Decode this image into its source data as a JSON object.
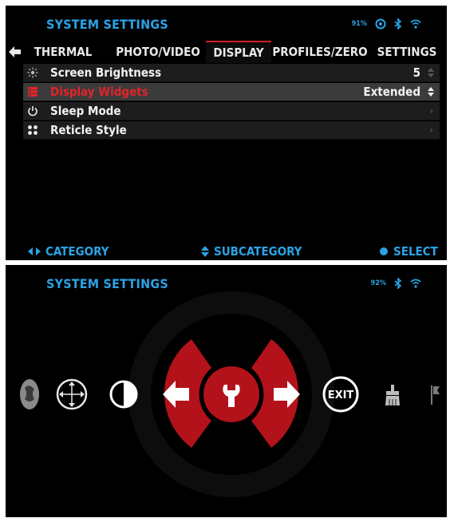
{
  "top_screen": {
    "title": "SYSTEM SETTINGS",
    "battery": "91%",
    "tabs": [
      {
        "label": "THERMAL"
      },
      {
        "label": "PHOTO/VIDEO"
      },
      {
        "label": "DISPLAY",
        "active": true
      },
      {
        "label": "PROFILES/ZERO"
      },
      {
        "label": "SETTINGS"
      }
    ],
    "rows": [
      {
        "label": "Screen Brightness",
        "value": "5",
        "icon": "brightness-icon"
      },
      {
        "label": "Display Widgets",
        "value": "Extended",
        "icon": "widgets-icon",
        "selected": true
      },
      {
        "label": "Sleep Mode",
        "value": "",
        "icon": "power-icon"
      },
      {
        "label": "Reticle Style",
        "value": "",
        "icon": "reticle-dots-icon"
      }
    ],
    "footer": {
      "category": "CATEGORY",
      "subcategory": "SUBCATEGORY",
      "select": "SELECT"
    }
  },
  "bottom_screen": {
    "title": "SYSTEM SETTINGS",
    "battery": "92%",
    "exit_label": "EXIT",
    "menu_icons": [
      "palette-icon",
      "crosshair-move-icon",
      "contrast-icon",
      "left-arrow-icon",
      "wrench-icon",
      "right-arrow-icon",
      "exit-icon",
      "brush-icon",
      "flag-icon"
    ]
  },
  "colors": {
    "accent_blue": "#2aa3e6",
    "accent_red": "#c0141c",
    "selected_text": "#e3232a",
    "background": "#000000"
  }
}
